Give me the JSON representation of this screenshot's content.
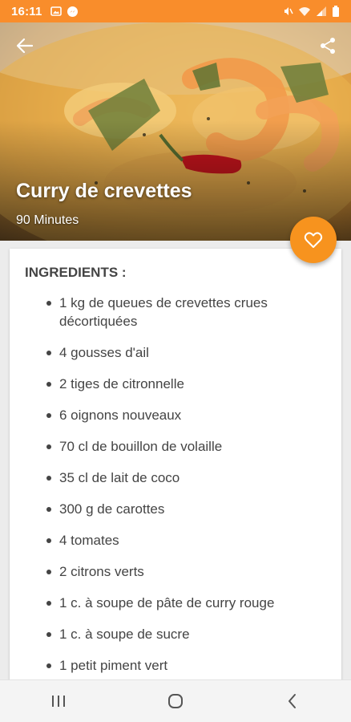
{
  "status_bar": {
    "time": "16:11",
    "left_icons": [
      "image-icon",
      "messenger-icon"
    ],
    "right_icons": [
      "mute-icon",
      "wifi-icon",
      "signal-icon",
      "battery-icon"
    ],
    "background": "#f98d2b"
  },
  "header": {
    "back_icon": "arrow-left-icon",
    "share_icon": "share-icon"
  },
  "recipe": {
    "title": "Curry de crevettes",
    "duration": "90 Minutes"
  },
  "favorite": {
    "icon": "heart-icon",
    "color": "#f7931e"
  },
  "ingredients": {
    "heading": "INGREDIENTS :",
    "items": [
      "1 kg de queues de crevettes crues décortiquées",
      "4 gousses d'ail",
      "2 tiges de citronnelle",
      "6 oignons nouveaux",
      "70 cl de bouillon de volaille",
      "35 cl de lait de coco",
      "300 g de carottes",
      "4 tomates",
      "2 citrons verts",
      "1 c. à soupe de pâte de curry rouge",
      "1 c. à soupe de sucre",
      "1 petit piment vert"
    ]
  },
  "nav_bar": {
    "buttons": [
      "recents-icon",
      "home-icon",
      "back-icon"
    ]
  }
}
